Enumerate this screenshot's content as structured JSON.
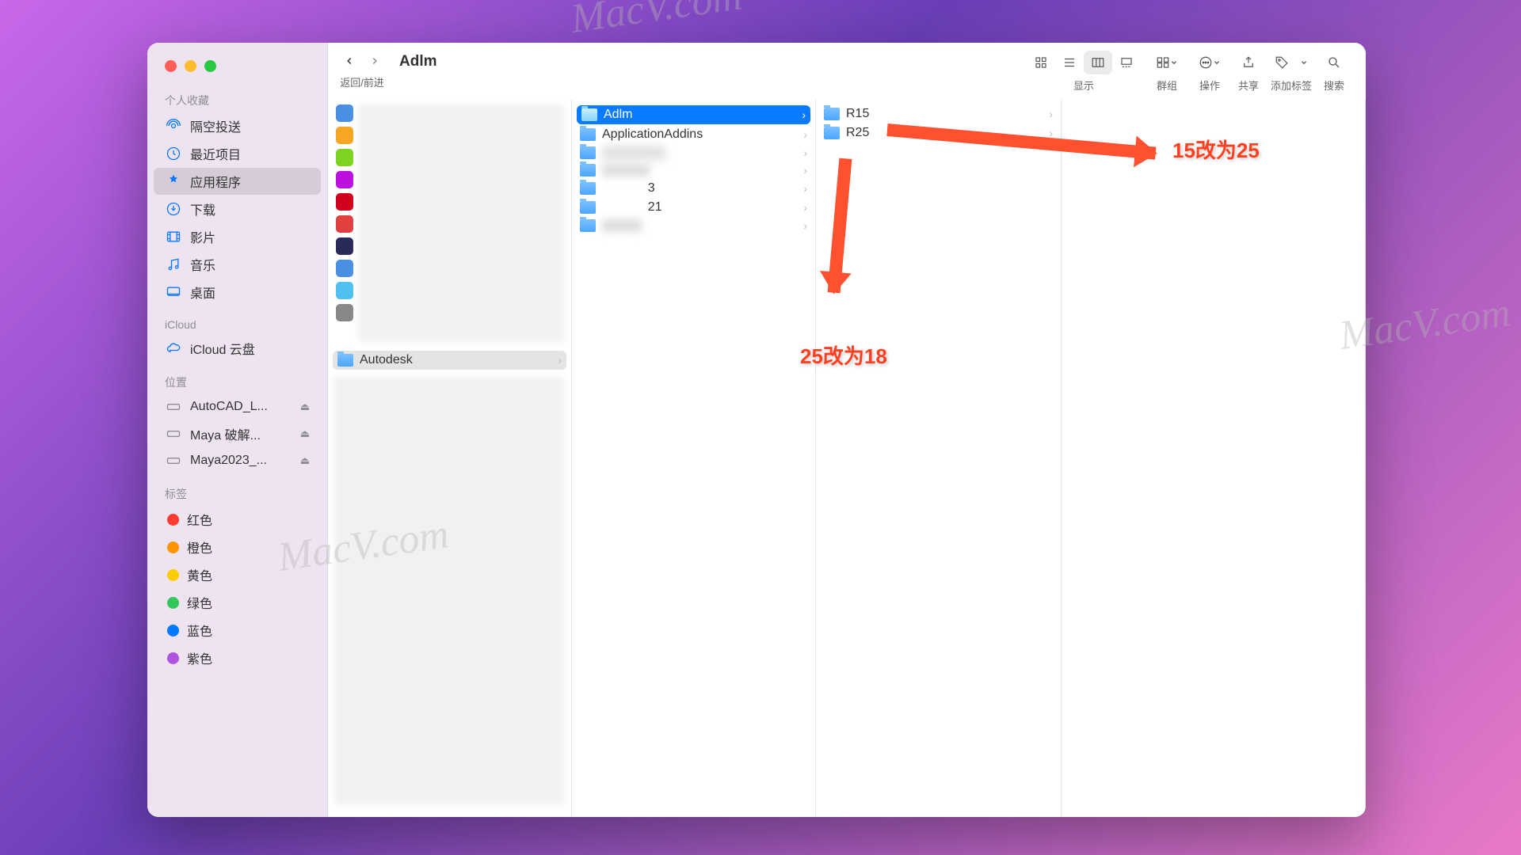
{
  "window": {
    "title": "Adlm",
    "nav_label": "返回/前进"
  },
  "toolbar": {
    "view_label": "显示",
    "group_label": "群组",
    "action_label": "操作",
    "share_label": "共享",
    "tags_label": "添加标签",
    "search_label": "搜索"
  },
  "sidebar": {
    "favorites_head": "个人收藏",
    "favorites": [
      {
        "label": "隔空投送",
        "icon": "airdrop"
      },
      {
        "label": "最近项目",
        "icon": "clock"
      },
      {
        "label": "应用程序",
        "icon": "apps",
        "selected": true
      },
      {
        "label": "下载",
        "icon": "download"
      },
      {
        "label": "影片",
        "icon": "movie"
      },
      {
        "label": "音乐",
        "icon": "music"
      },
      {
        "label": "桌面",
        "icon": "desktop"
      }
    ],
    "icloud_head": "iCloud",
    "icloud": [
      {
        "label": "iCloud 云盘",
        "icon": "cloud"
      }
    ],
    "locations_head": "位置",
    "locations": [
      {
        "label": "AutoCAD_L..."
      },
      {
        "label": "Maya 破解..."
      },
      {
        "label": "Maya2023_..."
      }
    ],
    "tags_head": "标签",
    "tags": [
      {
        "label": "红色",
        "color": "#ff3b30"
      },
      {
        "label": "橙色",
        "color": "#ff9500"
      },
      {
        "label": "黄色",
        "color": "#ffcc00"
      },
      {
        "label": "绿色",
        "color": "#34c759"
      },
      {
        "label": "蓝色",
        "color": "#007aff"
      },
      {
        "label": "紫色",
        "color": "#af52de"
      }
    ]
  },
  "col1": {
    "selected_label": "Autodesk"
  },
  "col2": {
    "items": [
      {
        "label": "Adlm",
        "selected": true
      },
      {
        "label": "ApplicationAddins"
      },
      {
        "label": ""
      },
      {
        "label": "             3"
      },
      {
        "label": "             21"
      },
      {
        "label": "             aya"
      },
      {
        "label": ""
      }
    ]
  },
  "col3": {
    "items": [
      {
        "label": "R15"
      },
      {
        "label": "R25"
      }
    ]
  },
  "annotations": {
    "a1": "15改为25",
    "a2": "25改为18"
  },
  "watermark": "MacV.com"
}
